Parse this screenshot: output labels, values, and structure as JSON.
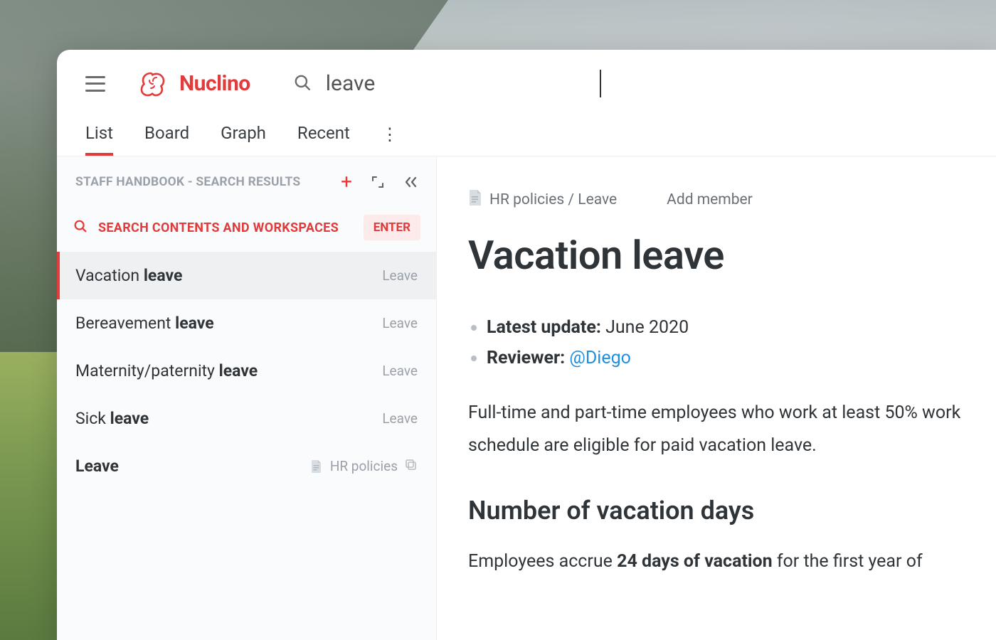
{
  "brand": {
    "name": "Nuclino"
  },
  "search": {
    "value": "leave"
  },
  "tabs": [
    {
      "label": "List",
      "active": true
    },
    {
      "label": "Board",
      "active": false
    },
    {
      "label": "Graph",
      "active": false
    },
    {
      "label": "Recent",
      "active": false
    }
  ],
  "sidebar": {
    "title": "STAFF HANDBOOK - SEARCH RESULTS",
    "search_contents_label": "SEARCH CONTENTS AND WORKSPACES",
    "enter_badge": "ENTER",
    "results": [
      {
        "prefix": "Vacation ",
        "bold": "leave",
        "suffix": "",
        "category": "Leave",
        "active": true
      },
      {
        "prefix": "Bereavement ",
        "bold": "leave",
        "suffix": "",
        "category": "Leave",
        "active": false
      },
      {
        "prefix": "Maternity/paternity ",
        "bold": "leave",
        "suffix": "",
        "category": "Leave",
        "active": false
      },
      {
        "prefix": "Sick ",
        "bold": "leave",
        "suffix": "",
        "category": "Leave",
        "active": false
      },
      {
        "prefix": "",
        "bold": "Leave",
        "suffix": "",
        "category": "HR policies",
        "active": false,
        "has_doc_icon": true,
        "has_copy_icon": true
      }
    ]
  },
  "main": {
    "breadcrumb": "HR policies / Leave",
    "add_member": "Add member",
    "title": "Vacation leave",
    "latest_update_label": "Latest update:",
    "latest_update_value": " June 2020",
    "reviewer_label": "Reviewer:",
    "reviewer_mention": "@Diego",
    "intro": "Full-time and part-time employees who work at least 50% work schedule are eligible for paid vacation leave.",
    "section_heading": "Number of vacation days",
    "section_body_prefix": "Employees accrue ",
    "section_body_bold": "24 days of vacation",
    "section_body_suffix": " for the first year of"
  }
}
